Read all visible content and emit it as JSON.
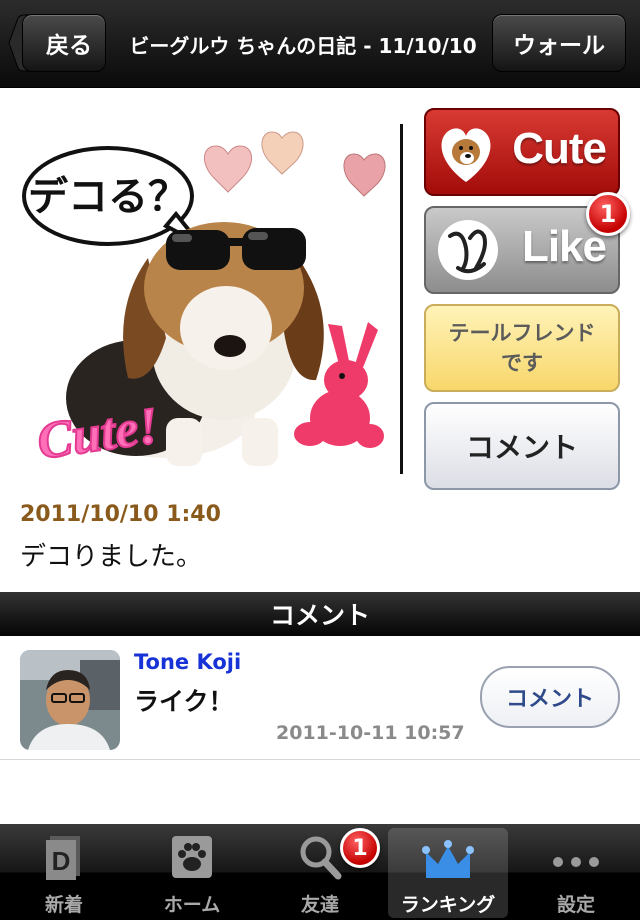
{
  "navbar": {
    "back_label": "戻る",
    "title": "ビーグルウ ちゃんの日記 - 11/10/10",
    "wall_label": "ウォール"
  },
  "photo": {
    "speech_text": "デコる？",
    "cute_stamp": "Cute!"
  },
  "actions": {
    "cute_label": "Cute",
    "like_label": "Like",
    "like_badge": "1",
    "tail_friend_label": "テールフレンドです",
    "comment_label": "コメント"
  },
  "post": {
    "date": "2011/10/10 1:40",
    "text": "デコりました。"
  },
  "comments_section": {
    "header": "コメント",
    "items": [
      {
        "name": "Tone Koji",
        "text": "ライク！",
        "time": "2011-10-11 10:57",
        "button": "コメント"
      }
    ]
  },
  "tabbar": {
    "tabs": [
      {
        "label": "新着",
        "icon": "d-icon"
      },
      {
        "label": "ホーム",
        "icon": "paw-icon"
      },
      {
        "label": "友達",
        "icon": "magnifier-icon"
      },
      {
        "label": "ランキング",
        "icon": "crown-icon"
      },
      {
        "label": "設定",
        "icon": "more-dots-icon"
      }
    ],
    "friends_badge": "1",
    "active_index": 3
  },
  "colors": {
    "cute_red": "#c81a14",
    "link_blue": "#1732d6",
    "date_brown": "#8a5a1c",
    "crown_blue": "#3a8ee6"
  }
}
